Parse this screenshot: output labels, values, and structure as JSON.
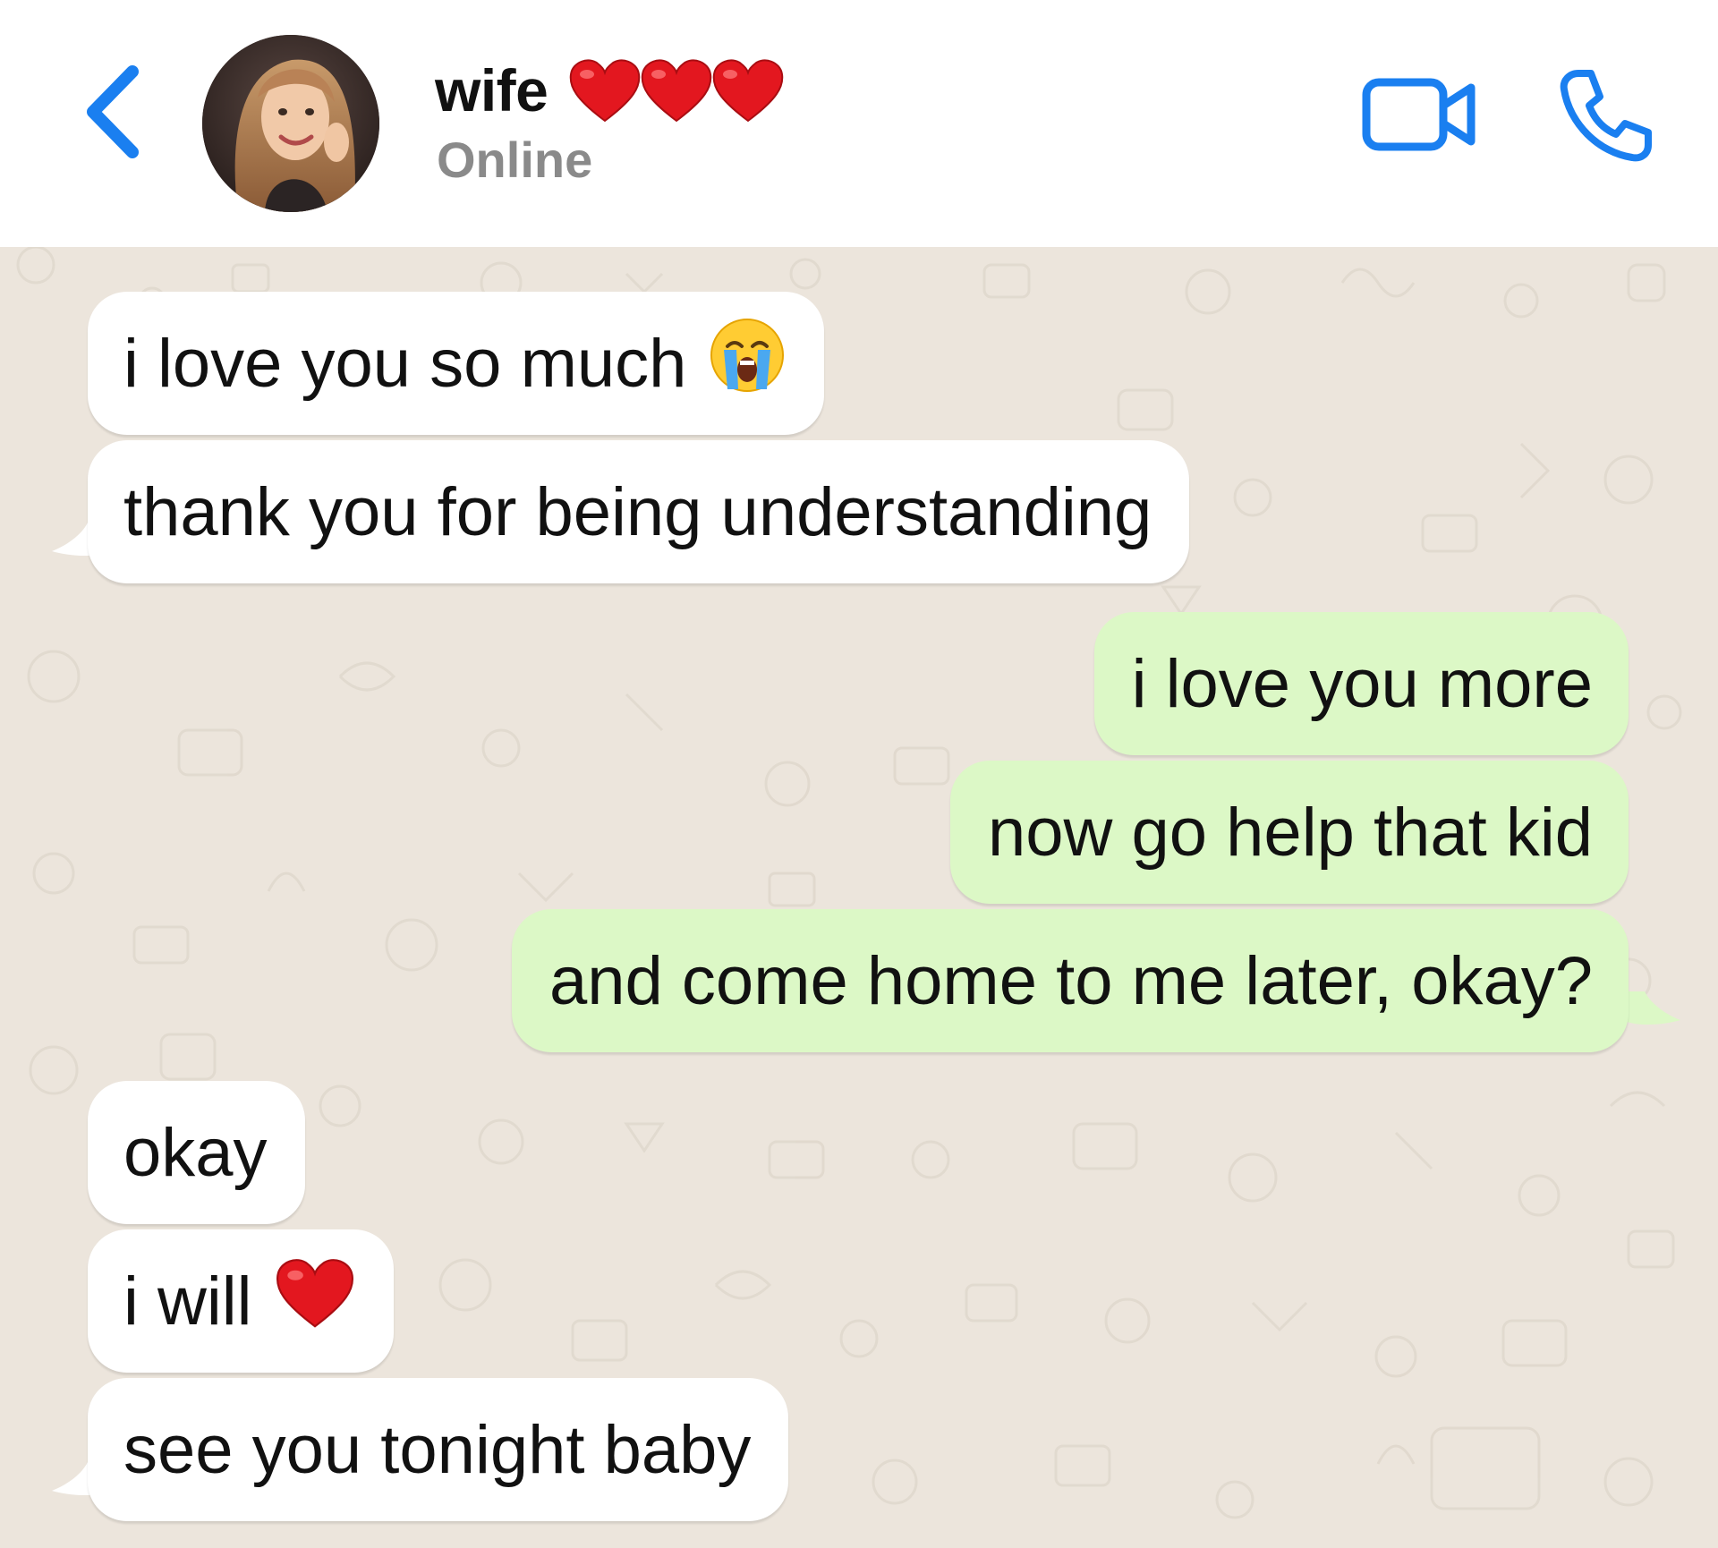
{
  "header": {
    "contact_name": "wife",
    "status": "Online",
    "name_emoji": "heart-emoji x3",
    "accent_color": "#1a7ff0"
  },
  "messages": [
    {
      "direction": "incoming",
      "text": "i love you so much",
      "emoji": "loudly-crying-face"
    },
    {
      "direction": "incoming",
      "text": "thank you for being understanding"
    },
    {
      "direction": "outgoing",
      "text": "i love you more"
    },
    {
      "direction": "outgoing",
      "text": "now go help that kid"
    },
    {
      "direction": "outgoing",
      "text": "and come home to me later, okay?"
    },
    {
      "direction": "incoming",
      "text": "okay"
    },
    {
      "direction": "incoming",
      "text": "i will",
      "emoji": "red-heart"
    },
    {
      "direction": "incoming",
      "text": "see you tonight baby"
    }
  ],
  "colors": {
    "incoming_bubble": "#ffffff",
    "outgoing_bubble": "#dcf8c6",
    "chat_background": "#ece5dc"
  }
}
